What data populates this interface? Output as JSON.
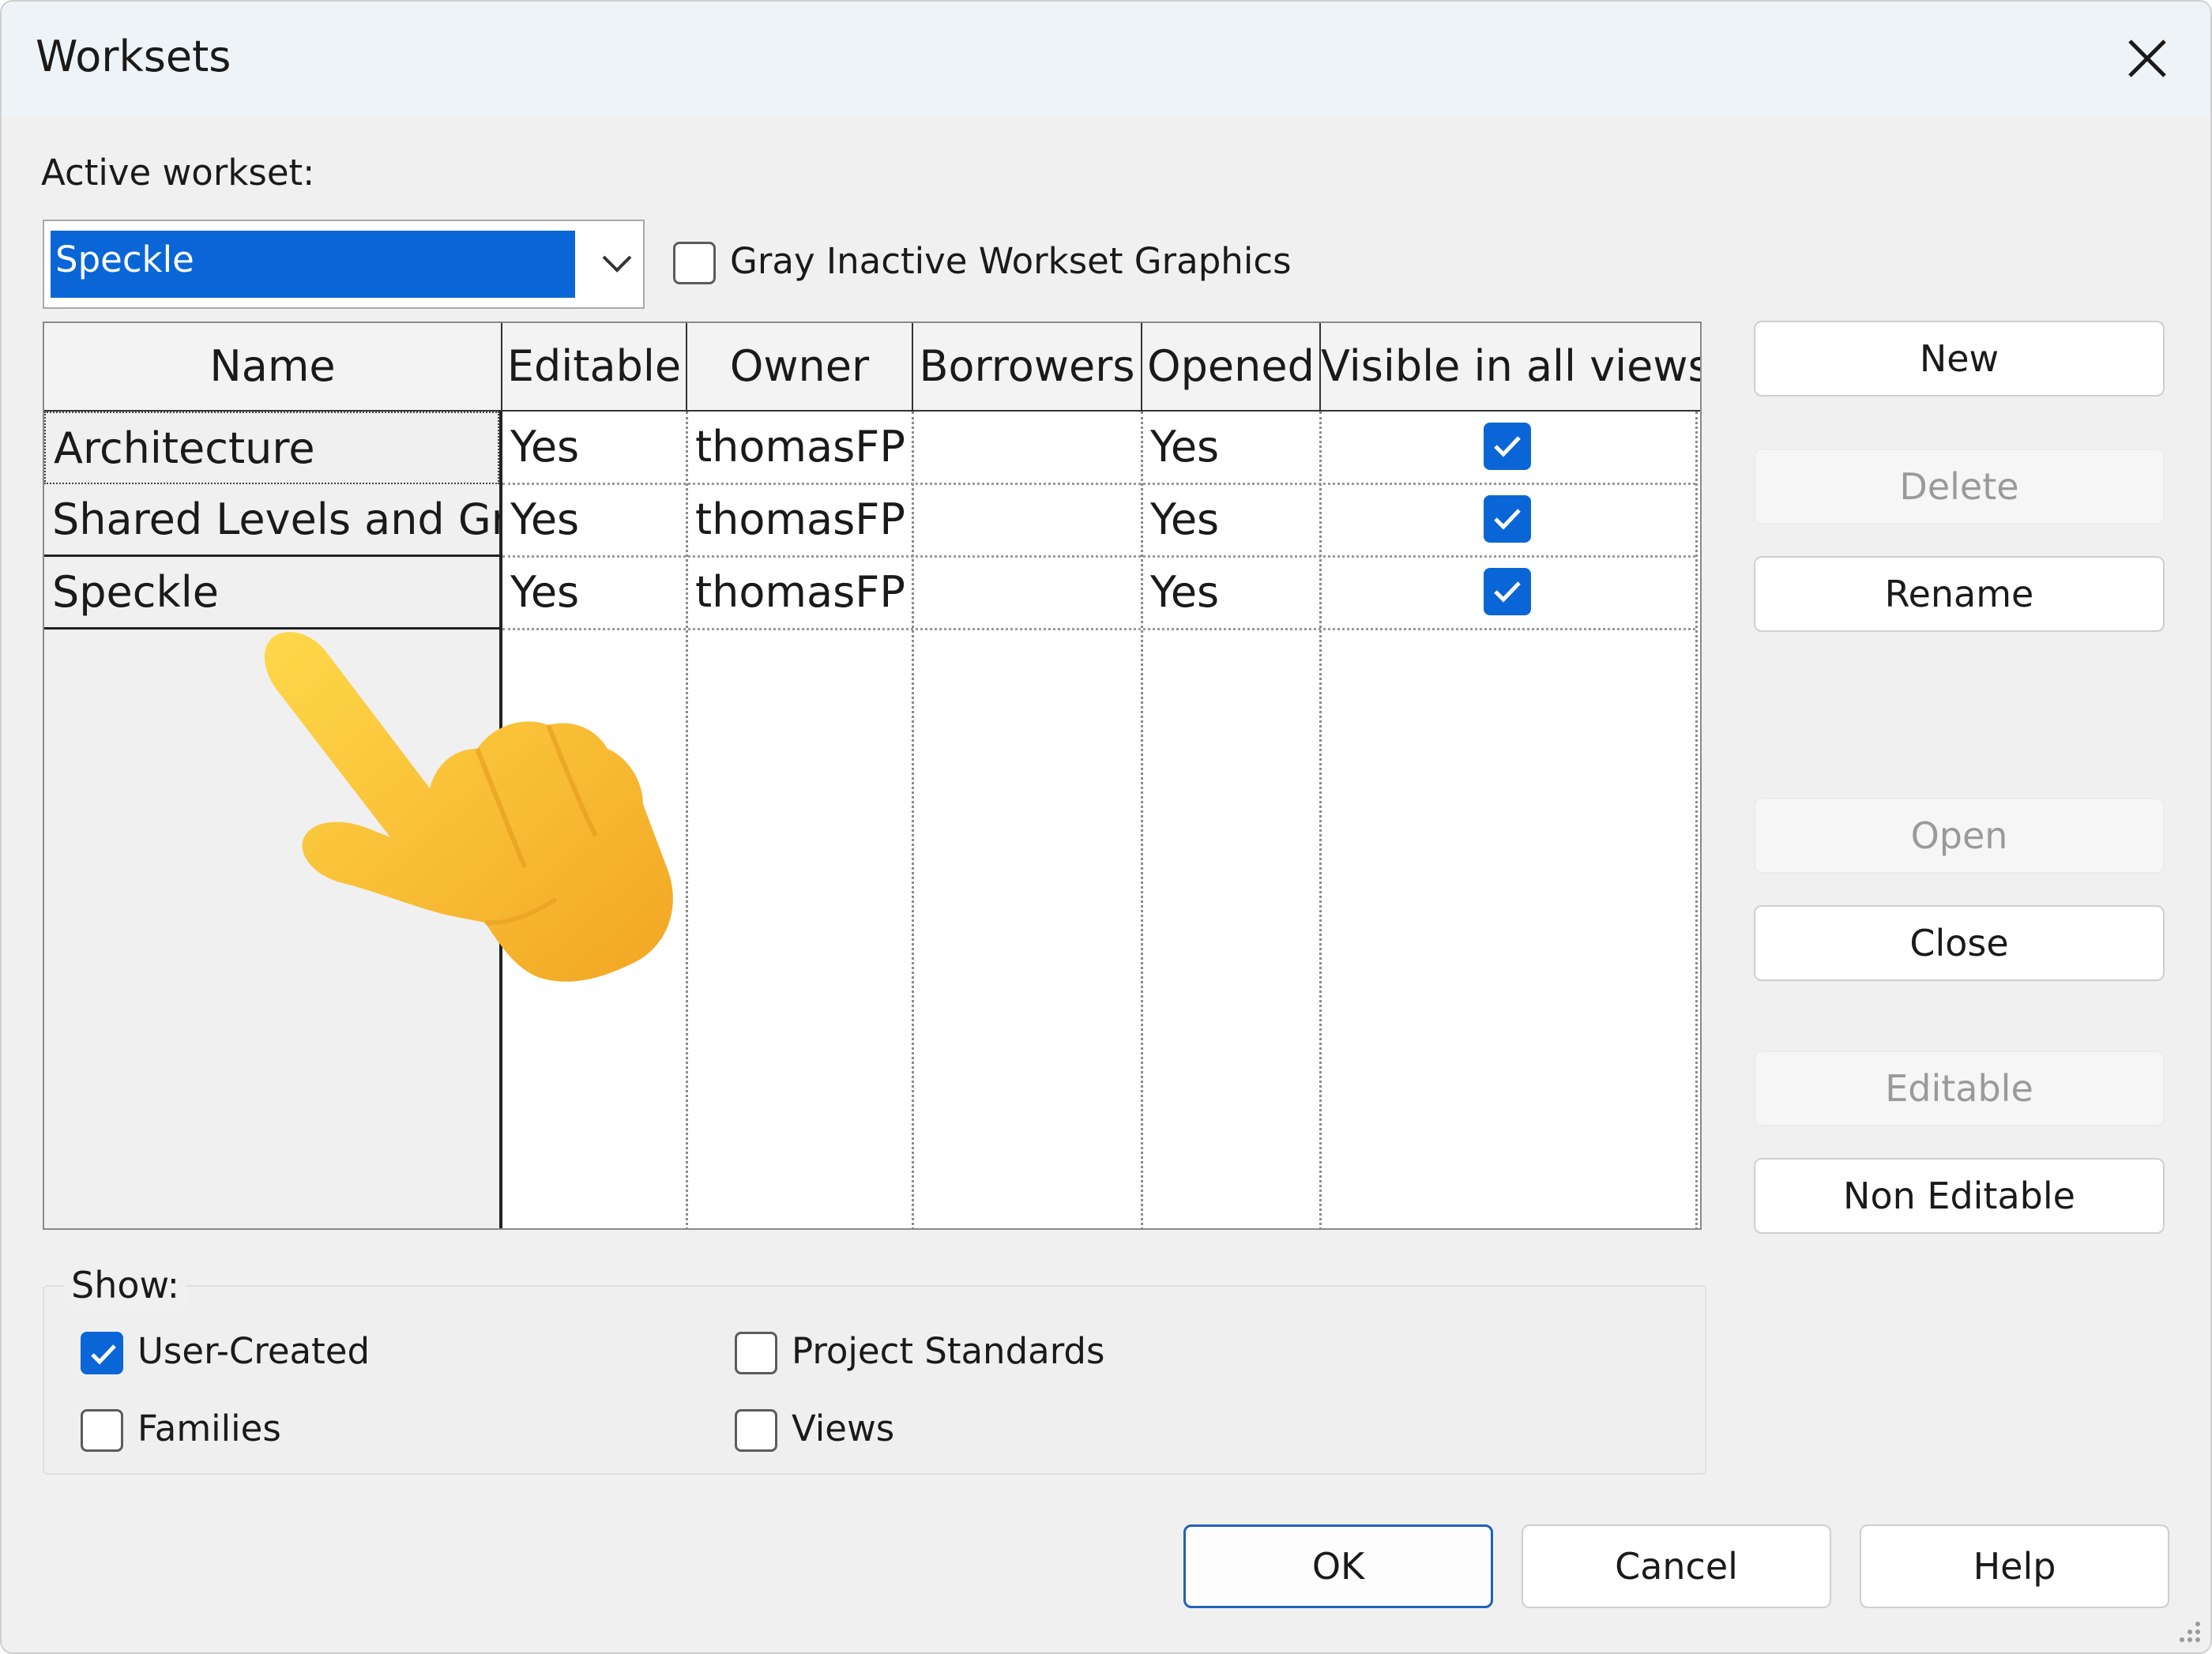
{
  "dialog": {
    "title": "Worksets",
    "active_workset_label": "Active workset:",
    "active_workset_value": "Speckle",
    "gray_inactive_label": "Gray Inactive Workset Graphics",
    "gray_inactive_checked": false
  },
  "table": {
    "columns": [
      "Name",
      "Editable",
      "Owner",
      "Borrowers",
      "Opened",
      "Visible in all views"
    ],
    "rows": [
      {
        "name": "Architecture",
        "editable": "Yes",
        "owner": "thomasFP",
        "borrowers": "",
        "opened": "Yes",
        "visible": true
      },
      {
        "name": "Shared Levels and Gri",
        "editable": "Yes",
        "owner": "thomasFP",
        "borrowers": "",
        "opened": "Yes",
        "visible": true
      },
      {
        "name": "Speckle",
        "editable": "Yes",
        "owner": "thomasFP",
        "borrowers": "",
        "opened": "Yes",
        "visible": true
      }
    ]
  },
  "side_buttons": {
    "new": "New",
    "delete": "Delete",
    "rename": "Rename",
    "open": "Open",
    "close": "Close",
    "editable": "Editable",
    "non_editable": "Non Editable"
  },
  "show": {
    "title": "Show:",
    "user_created": {
      "label": "User-Created",
      "checked": true
    },
    "families": {
      "label": "Families",
      "checked": false
    },
    "project_standards": {
      "label": "Project Standards",
      "checked": false
    },
    "views": {
      "label": "Views",
      "checked": false
    }
  },
  "footer": {
    "ok": "OK",
    "cancel": "Cancel",
    "help": "Help"
  },
  "overlay": {
    "icon": "pointing-hand-icon"
  },
  "colors": {
    "accent": "#0a66d6",
    "default_button_border": "#1f62b8"
  }
}
